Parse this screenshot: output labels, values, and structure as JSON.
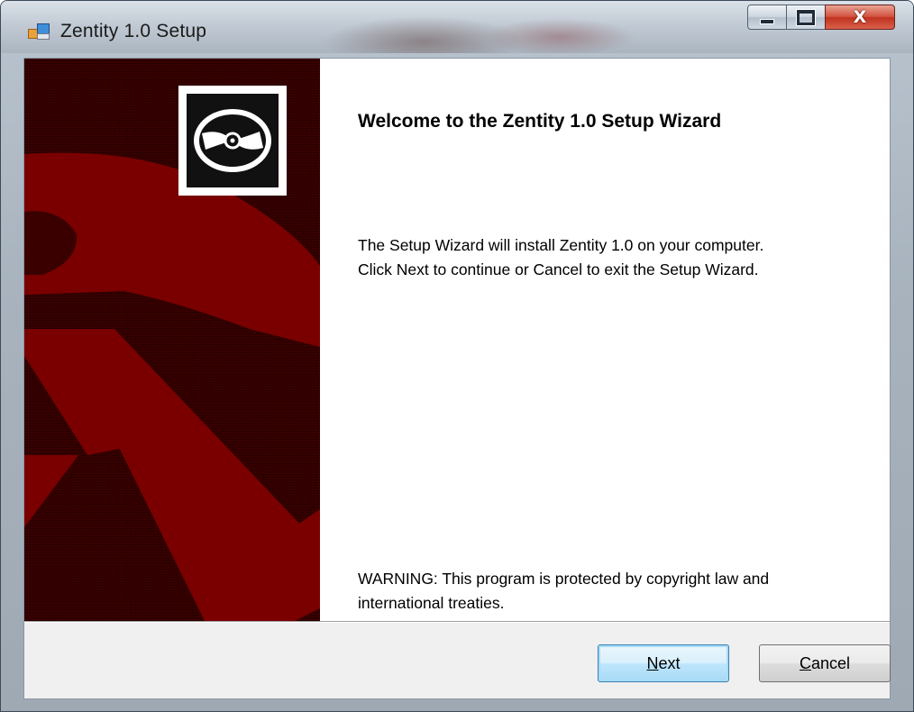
{
  "window": {
    "title": "Zentity 1.0 Setup",
    "close_glyph": "X",
    "icons": [
      "app-icon",
      "minimize-icon",
      "maximize-icon",
      "close-icon"
    ]
  },
  "banner": {
    "icons": [
      "cd-disc-icon",
      "anchor-graphic"
    ],
    "colors": {
      "dark": "#3a0000",
      "accent": "#7a0000"
    }
  },
  "content": {
    "title": "Welcome to the Zentity 1.0 Setup Wizard",
    "intro_line1": "The Setup Wizard will install Zentity 1.0 on your computer.",
    "intro_line2": "Click Next to continue or Cancel to exit the Setup Wizard.",
    "warning_line1": "WARNING: This program is protected by copyright law and",
    "warning_line2": "international treaties."
  },
  "buttons": {
    "next_mnemonic": "N",
    "next_rest": "ext",
    "cancel_mnemonic": "C",
    "cancel_rest": "ancel"
  }
}
